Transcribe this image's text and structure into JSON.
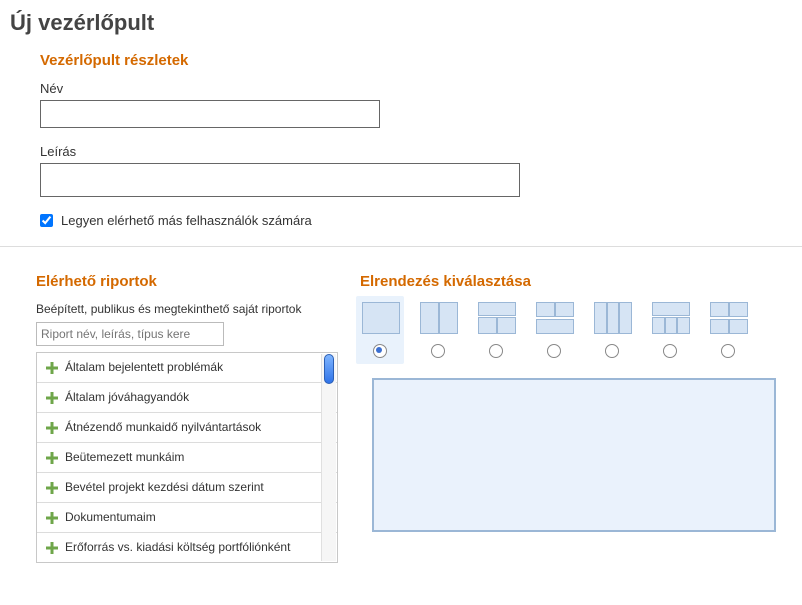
{
  "page_title": "Új vezérlőpult",
  "details": {
    "section_title": "Vezérlőpult részletek",
    "name_label": "Név",
    "name_value": "",
    "desc_label": "Leírás",
    "desc_value": "",
    "share_label": "Legyen elérhető más felhasználók számára",
    "share_checked": true
  },
  "reports": {
    "section_title": "Elérhető riportok",
    "subtitle": "Beépített, publikus és megtekinthető saját riportok",
    "filter_placeholder": "Riport név, leírás, típus kere",
    "items": [
      "Általam bejelentett problémák",
      "Általam jóváhagyandók",
      "Átnézendő munkaidő nyilvántartások",
      "Beütemezett munkáim",
      "Bevétel projekt kezdési dátum szerint",
      "Dokumentumaim",
      "Erőforrás vs. kiadási költség portfóliónként"
    ]
  },
  "layout": {
    "section_title": "Elrendezés kiválasztása",
    "selected_index": 0
  }
}
